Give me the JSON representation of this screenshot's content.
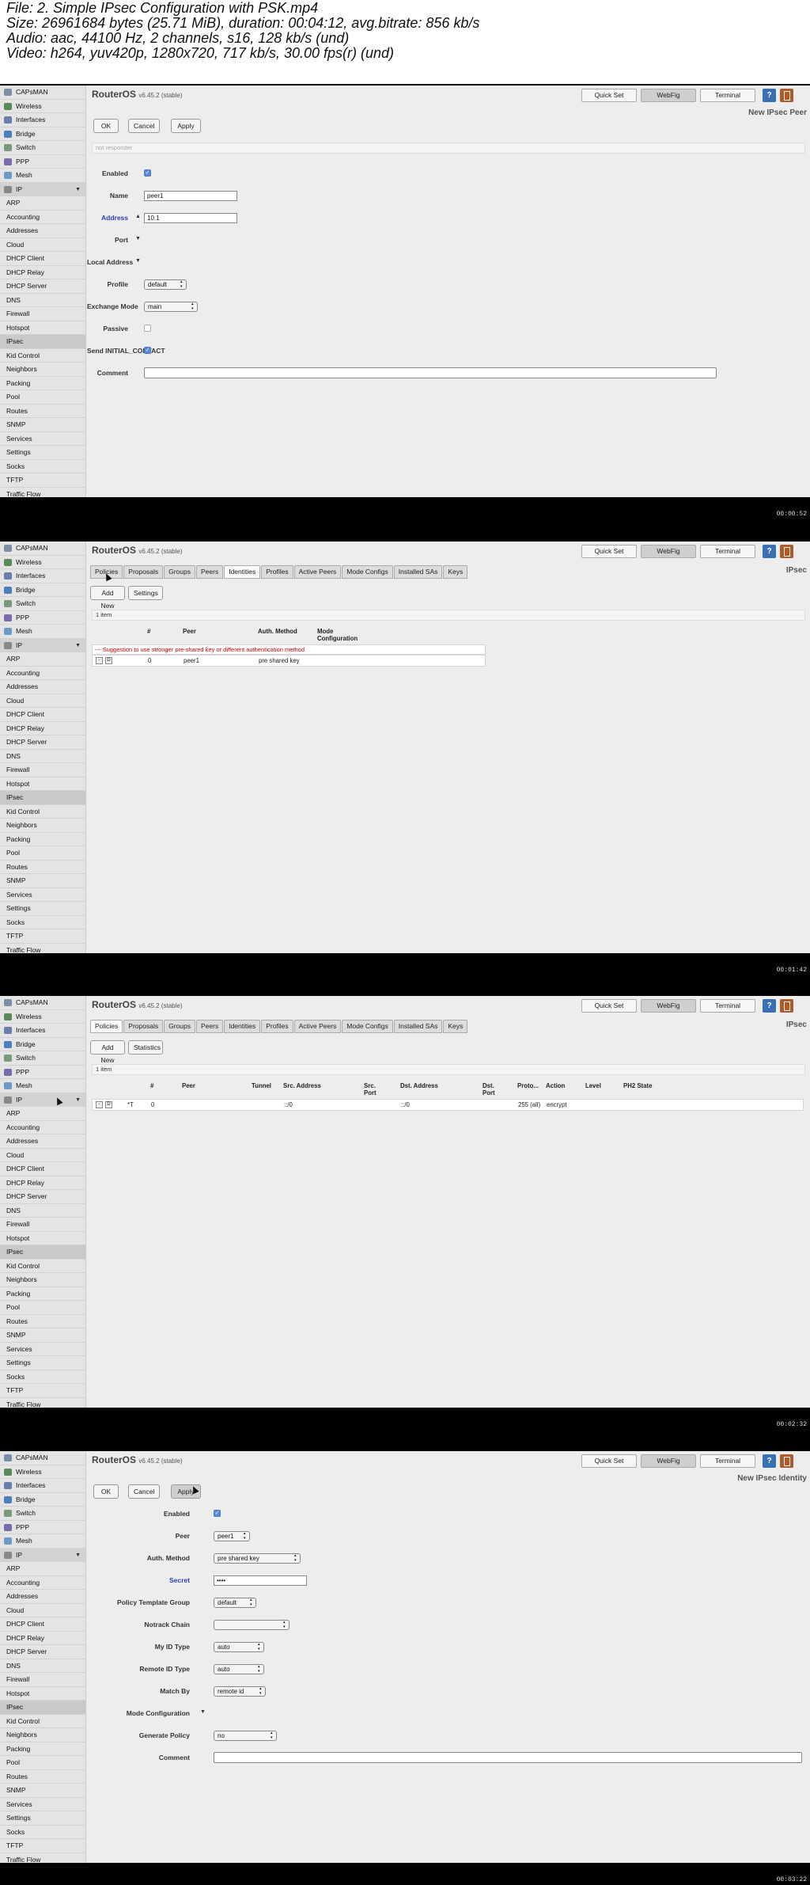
{
  "header": {
    "line1": "File: 2. Simple IPsec Configuration with PSK.mp4",
    "line2": "Size: 26961684 bytes (25.71 MiB), duration: 00:04:12, avg.bitrate: 856 kb/s",
    "line3": "Audio: aac, 44100 Hz, 2 channels, s16, 128 kb/s (und)",
    "line4": "Video: h264, yuv420p, 1280x720, 717 kb/s, 30.00 fps(r) (und)"
  },
  "common": {
    "brand": "RouterOS",
    "version": "v6.45.2 (stable)",
    "quick_set": "Quick Set",
    "webfig": "WebFig",
    "terminal": "Terminal",
    "help": "?",
    "sidebar": [
      "CAPsMAN",
      "Wireless",
      "Interfaces",
      "Bridge",
      "Switch",
      "PPP",
      "Mesh",
      "IP",
      "ARP",
      "Accounting",
      "Addresses",
      "Cloud",
      "DHCP Client",
      "DHCP Relay",
      "DHCP Server",
      "DNS",
      "Firewall",
      "Hotspot",
      "IPsec",
      "Kid Control",
      "Neighbors",
      "Packing",
      "Pool",
      "Routes",
      "SNMP",
      "Services",
      "Settings",
      "Socks",
      "TFTP",
      "Traffic Flow"
    ],
    "tabs": [
      "Policies",
      "Proposals",
      "Groups",
      "Peers",
      "Identities",
      "Profiles",
      "Active Peers",
      "Mode Configs",
      "Installed SAs",
      "Keys"
    ],
    "ipsec_title": "IPsec"
  },
  "frame1": {
    "timestamp": "00:00:52",
    "title": "New IPsec Peer",
    "ok": "OK",
    "cancel": "Cancel",
    "apply": "Apply",
    "status": "not responder",
    "enabled_label": "Enabled",
    "name_label": "Name",
    "name_value": "peer1",
    "address_label": "Address",
    "address_value": "10.1",
    "port_label": "Port",
    "local_address_label": "Local Address",
    "profile_label": "Profile",
    "profile_value": "default",
    "exchange_label": "Exchange Mode",
    "exchange_value": "main",
    "passive_label": "Passive",
    "initial_label": "Send INITIAL_CONTACT",
    "comment_label": "Comment"
  },
  "frame2": {
    "timestamp": "00:01:42",
    "add_new": "Add New",
    "settings": "Settings",
    "count": "1 item",
    "headers": [
      "#",
      "Peer",
      "Auth. Method",
      "Mode Configuration"
    ],
    "warning": "--- Suggestion to use stronger pre-shared key or different authentication method",
    "row": {
      "ctl1": "-",
      "ctl2": "D",
      "num": "0",
      "peer": "peer1",
      "auth": "pre shared key"
    }
  },
  "frame3": {
    "timestamp": "00:02:32",
    "add_new": "Add New",
    "statistics": "Statistics",
    "count": "1 item",
    "headers": [
      "#",
      "Peer",
      "Tunnel",
      "Src. Address",
      "Src. Port",
      "Dst. Address",
      "Dst. Port",
      "Proto...",
      "Action",
      "Level",
      "PH2 State"
    ],
    "row": {
      "ctl1": "-",
      "ctl2": "D",
      "flag": "*T",
      "num": "0",
      "src": "::/0",
      "dst": "::/0",
      "proto": "255 (all)",
      "action": "encrypt"
    }
  },
  "frame4": {
    "timestamp": "00:03:22",
    "title": "New IPsec Identity",
    "ok": "OK",
    "cancel": "Cancel",
    "apply": "Apply",
    "enabled_label": "Enabled",
    "peer_label": "Peer",
    "peer_value": "peer1",
    "auth_label": "Auth. Method",
    "auth_value": "pre shared key",
    "secret_label": "Secret",
    "secret_value": "••••",
    "ptg_label": "Policy Template Group",
    "ptg_value": "default",
    "notrack_label": "Notrack Chain",
    "notrack_value": "",
    "myid_label": "My ID Type",
    "myid_value": "auto",
    "remoteid_label": "Remote ID Type",
    "remoteid_value": "auto",
    "matchby_label": "Match By",
    "matchby_value": "remote id",
    "modeconf_label": "Mode Configuration",
    "genpolicy_label": "Generate Policy",
    "genpolicy_value": "no",
    "comment_label": "Comment"
  },
  "colors": {
    "accent_blue": "#2a3fb0",
    "warning_red": "#cc0000",
    "help_blue": "#3a6fb4"
  }
}
